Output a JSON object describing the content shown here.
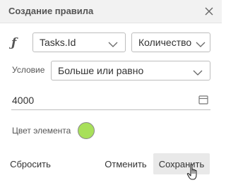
{
  "dialog": {
    "title": "Создание правила",
    "close_icon": "close-icon"
  },
  "function_icon": "function-icon",
  "field": {
    "value": "Tasks.Id"
  },
  "aggregation": {
    "value": "Количество"
  },
  "condition": {
    "label": "Условие",
    "value": "Больше или равно"
  },
  "threshold": {
    "value": "4000",
    "icon": "calendar-icon"
  },
  "element_color": {
    "label": "Цвет элемента",
    "color": "#a8e05a"
  },
  "buttons": {
    "reset": "Сбросить",
    "cancel": "Отменить",
    "save": "Сохранить"
  },
  "cursor": "hand-pointer-cursor"
}
